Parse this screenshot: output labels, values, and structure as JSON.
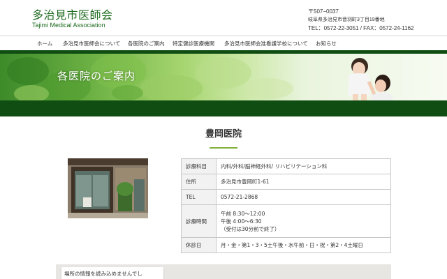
{
  "header": {
    "site_title": "多治見市医師会",
    "site_subtitle": "Tajimi Medical Association",
    "postal": "〒507−0037",
    "address": "岐阜県多治見市音羽町3丁目19番地",
    "contact": "TEL：0572-22-3051 / FAX：0572-24-1162"
  },
  "nav": {
    "items": [
      {
        "label": "ホーム"
      },
      {
        "label": "多治見市医師会について"
      },
      {
        "label": "各医院のご案内"
      },
      {
        "label": "特定健診医療機関"
      },
      {
        "label": "多治見市医師会准看護学校について"
      },
      {
        "label": "お知らせ"
      }
    ]
  },
  "hero": {
    "title": "各医院のご案内"
  },
  "clinic": {
    "name": "豊岡医院",
    "rows": [
      {
        "key": "診療科目",
        "value": "内科/外科/脳神経外科/ リハビリテーション科"
      },
      {
        "key": "住所",
        "value": "多治見市豊岡町1-61"
      },
      {
        "key": "TEL",
        "value": "0572-21-2868"
      },
      {
        "key": "診療時間",
        "lines": [
          "午前 8:30〜12:00",
          "午後 4:00〜6:30",
          "（受付は30分前で終了）"
        ]
      },
      {
        "key": "休診日",
        "value": "月・金・第1・3・5土午後・水午前・日・祝・第2・4土曜日"
      }
    ]
  },
  "map": {
    "error_message": "場所の情報を読み込めませんでし"
  },
  "colors": {
    "brand_green": "#1e6b1f",
    "dark_green": "#0f4d12",
    "accent_green": "#7fb03a"
  }
}
